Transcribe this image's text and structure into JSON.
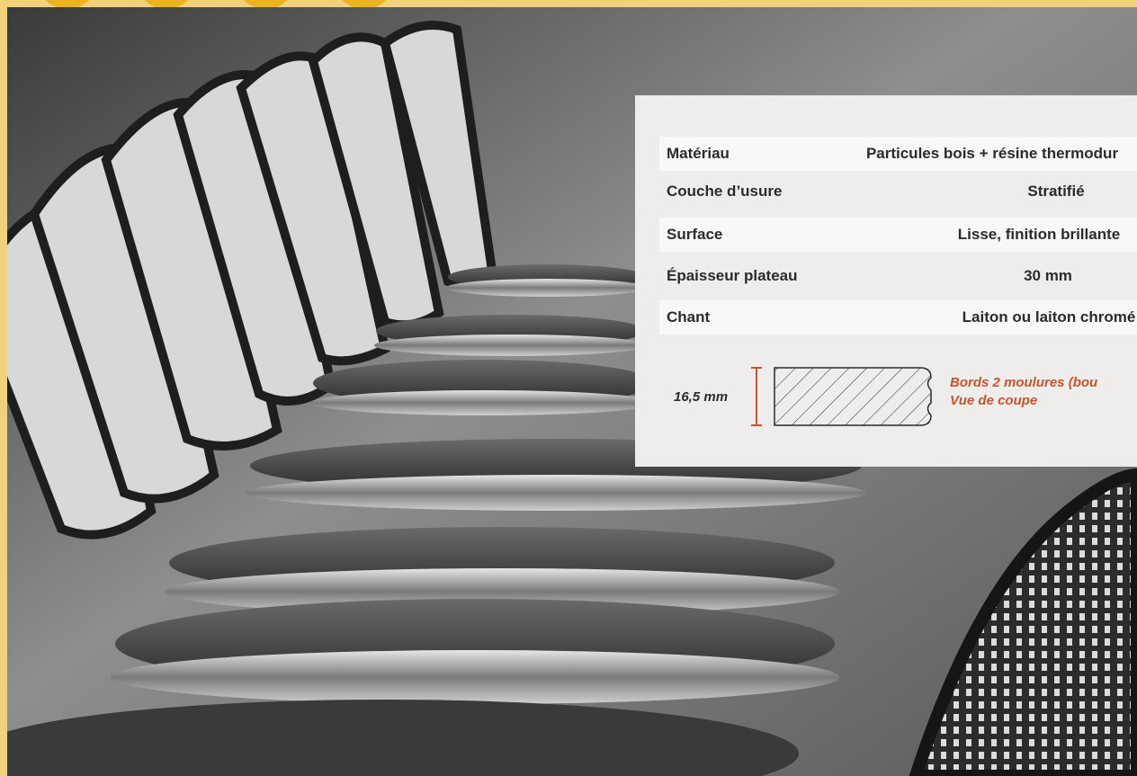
{
  "specs": {
    "rows": [
      {
        "label": "Matériau",
        "value": "Particules bois + résine thermodur"
      },
      {
        "label": "Couche d’usure",
        "value": "Stratifié"
      },
      {
        "label": "Surface",
        "value": "Lisse, finition brillante"
      },
      {
        "label": "Épaisseur plateau",
        "value": "30 mm"
      },
      {
        "label": "Chant",
        "value": "Laiton ou laiton chromé"
      }
    ]
  },
  "edge_profile": {
    "dimension": "16,5 mm",
    "caption_line1": "Bords 2 moulures (bou",
    "caption_line2": "Vue de coupe"
  },
  "colors": {
    "background_yellow": "#f3d98e",
    "brand_yellow": "#eab31f",
    "card_background": "#efedeb",
    "row_band": "#f9f8f7",
    "text_dark": "#2b2b2b",
    "accent_orange": "#c7542a"
  }
}
